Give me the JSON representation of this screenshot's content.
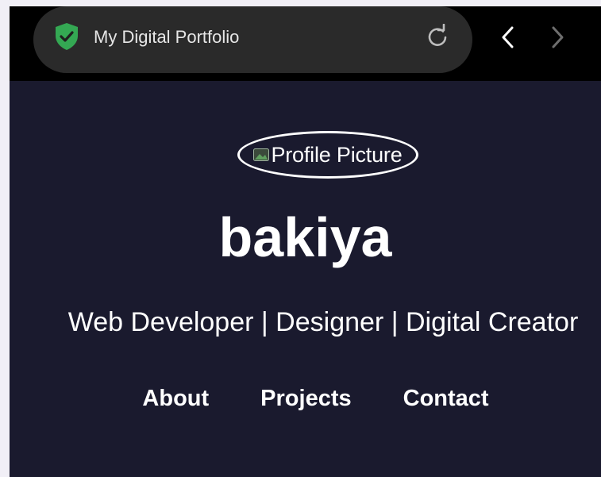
{
  "browser": {
    "page_title": "My Digital Portfolio",
    "security_icon": "shield-check-icon",
    "reload_icon": "reload-icon",
    "back_icon": "chevron-left-icon",
    "forward_icon": "chevron-right-icon",
    "colors": {
      "bar_background": "#000000",
      "pill_background": "#2a2a2a",
      "shield": "#34a853"
    }
  },
  "page": {
    "avatar_alt": "Profile Picture",
    "name": "bakiya",
    "tagline": "Web Developer | Designer | Digital Creator",
    "nav": [
      {
        "label": "About"
      },
      {
        "label": "Projects"
      },
      {
        "label": "Contact"
      }
    ],
    "colors": {
      "background": "#1a1a2e",
      "text": "#ffffff"
    }
  }
}
